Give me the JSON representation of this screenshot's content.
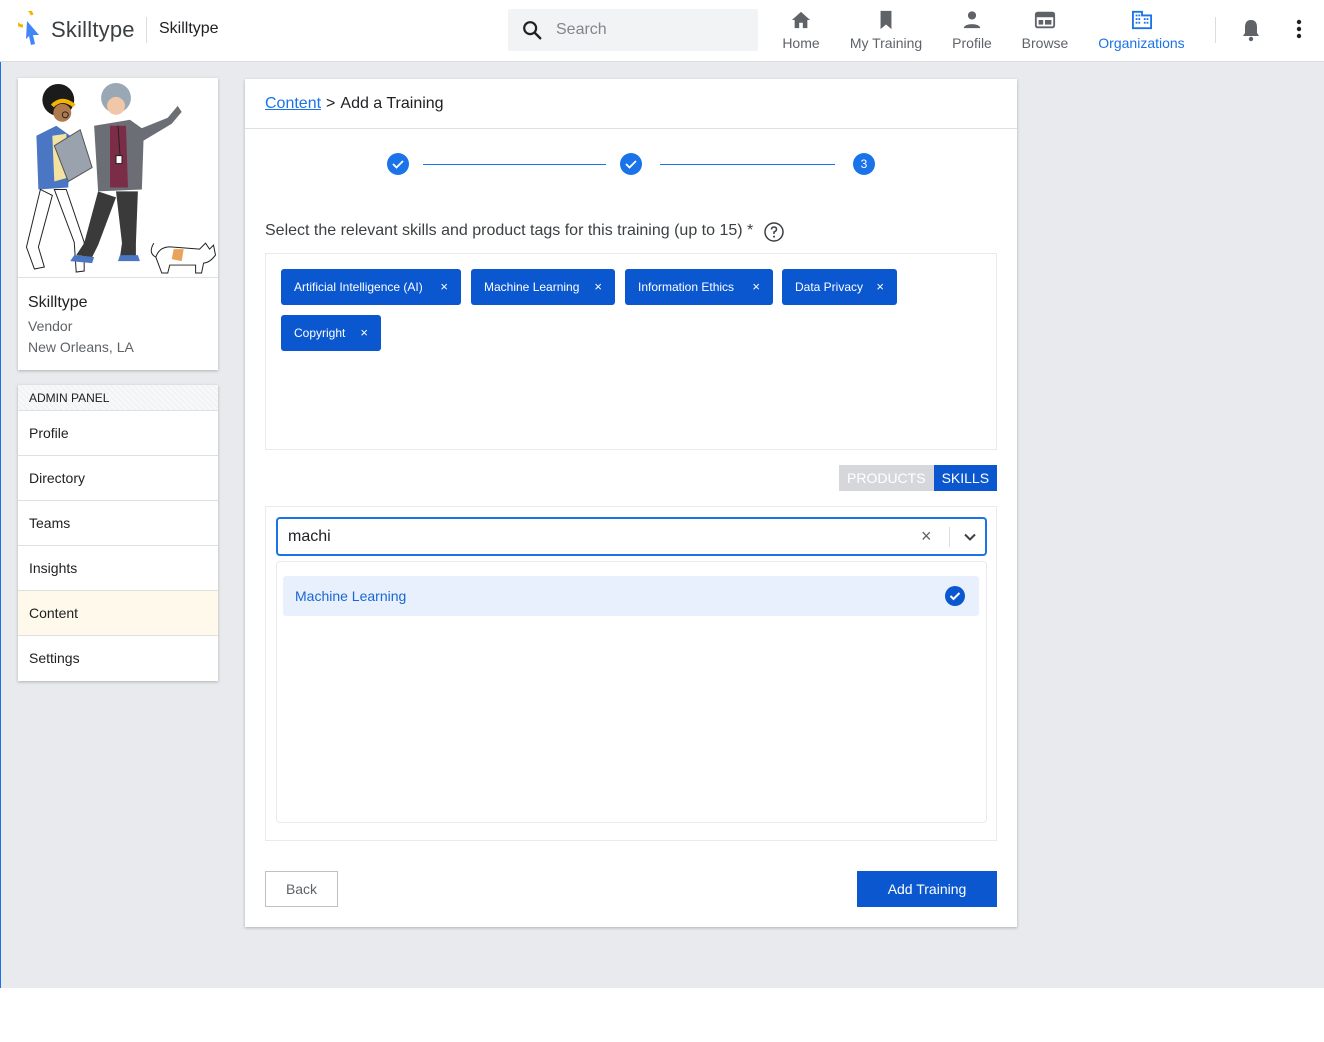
{
  "header": {
    "brand": "Skilltype",
    "org_name": "Skilltype",
    "search_placeholder": "Search",
    "nav": [
      {
        "label": "Home",
        "icon": "home-icon"
      },
      {
        "label": "My Training",
        "icon": "bookmark-icon"
      },
      {
        "label": "Profile",
        "icon": "person-icon"
      },
      {
        "label": "Browse",
        "icon": "browse-icon"
      },
      {
        "label": "Organizations",
        "icon": "organization-icon",
        "active": true
      }
    ]
  },
  "profile_card": {
    "name": "Skilltype",
    "role": "Vendor",
    "location": "New Orleans, LA"
  },
  "admin_panel": {
    "title": "ADMIN PANEL",
    "items": [
      {
        "label": "Profile"
      },
      {
        "label": "Directory"
      },
      {
        "label": "Teams"
      },
      {
        "label": "Insights"
      },
      {
        "label": "Content",
        "active": true
      },
      {
        "label": "Settings"
      }
    ]
  },
  "content": {
    "breadcrumb": {
      "link": "Content",
      "separator": ">",
      "current": "Add a Training"
    },
    "stepper": {
      "steps": [
        "done",
        "done",
        "3"
      ],
      "current_step": "3"
    },
    "prompt": "Select the relevant skills and product tags for this training (up to 15) *",
    "selected_tags": [
      "Artificial Intelligence (AI)",
      "Machine Learning",
      "Information Ethics",
      "Data Privacy",
      "Copyright"
    ],
    "tag_remove_glyph": "×",
    "toggle": {
      "products_label": "PRODUCTS",
      "skills_label": "SKILLS",
      "active": "SKILLS"
    },
    "search": {
      "value": "machi",
      "clear_glyph": "×"
    },
    "options": [
      {
        "label": "Machine Learning",
        "selected": true
      }
    ],
    "buttons": {
      "back": "Back",
      "add": "Add Training"
    }
  },
  "colors": {
    "primary": "#0b57d0",
    "link": "#1a73e8",
    "page_bg": "#e8eaed",
    "active_admin_bg": "#fef9ea",
    "option_bg": "#e8f0fe"
  }
}
